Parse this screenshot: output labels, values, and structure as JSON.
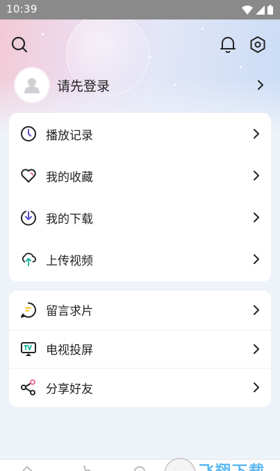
{
  "status_bar": {
    "time": "10:39"
  },
  "user": {
    "login_prompt": "请先登录"
  },
  "menu_group_1": [
    {
      "label": "播放记录",
      "icon": "clock-icon"
    },
    {
      "label": "我的收藏",
      "icon": "heart-icon"
    },
    {
      "label": "我的下载",
      "icon": "download-icon"
    },
    {
      "label": "上传视频",
      "icon": "upload-cloud-icon"
    }
  ],
  "menu_group_2": [
    {
      "label": "留言求片",
      "icon": "message-icon"
    },
    {
      "label": "电视投屏",
      "icon": "tv-cast-icon"
    },
    {
      "label": "分享好友",
      "icon": "share-icon"
    }
  ],
  "watermark": {
    "text": "飞翔下载"
  },
  "colors": {
    "accent_teal": "#19b49a",
    "accent_purple": "#5a4fcf",
    "accent_yellow": "#f5c518",
    "share_pink": "#f06b8f"
  }
}
